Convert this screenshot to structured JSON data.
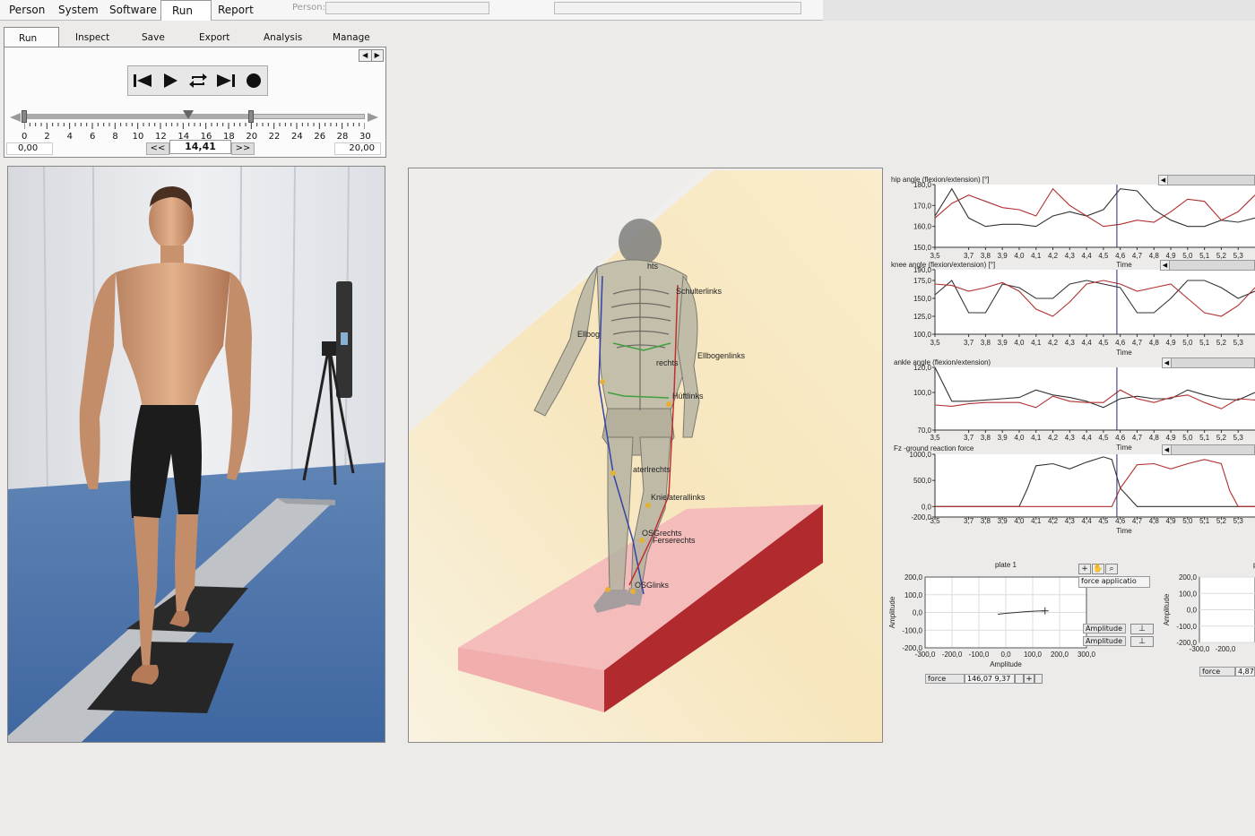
{
  "menu": {
    "items": [
      "Person",
      "System",
      "Software",
      "Run",
      "Report"
    ],
    "active": "Run",
    "person_label": "Person:"
  },
  "subtabs": {
    "items": [
      "Run",
      "Inspect",
      "Save",
      "Export",
      "Analysis",
      "Manage"
    ],
    "active": "Run"
  },
  "playback": {
    "tick_labels": [
      "0",
      "2",
      "4",
      "6",
      "8",
      "10",
      "12",
      "14",
      "16",
      "18",
      "20",
      "22",
      "24",
      "26",
      "28",
      "30"
    ],
    "start_value": "0,00",
    "current_value": "14,41",
    "end_value": "20,00",
    "step_back_label": "<<",
    "step_forward_label": ">>",
    "scale_min": 0,
    "scale_max": 30,
    "range_start": 0,
    "range_end": 20,
    "cursor_value": 14.41,
    "buttons": [
      "skip-start-icon",
      "play-icon",
      "loop-icon",
      "skip-end-icon",
      "record-icon"
    ]
  },
  "model": {
    "labels": [
      "hts",
      "Schulterlinks",
      "Ellbog",
      "Ellbogenlinks",
      "rechts",
      "Hüftlinks",
      "aterlrechts",
      "Knielaterallinks",
      "OSGrechts",
      "Ferserechts",
      "OSGlinks"
    ]
  },
  "chart_data": [
    {
      "type": "line",
      "title": "hip angle (flexion/extension) [°]",
      "xlabel": "Time",
      "x_ticks": [
        "3,5",
        "3,7",
        "3,8",
        "3,9",
        "4,0",
        "4,1",
        "4,2",
        "4,3",
        "4,4",
        "4,5",
        "4,6",
        "4,7",
        "4,8",
        "4,9",
        "5,0",
        "5,1",
        "5,2",
        "5,3"
      ],
      "y_ticks": [
        "180,0",
        "170,0",
        "160,0",
        "150,0"
      ],
      "ylim": [
        150,
        180
      ],
      "cursor_x": 4.58,
      "series": [
        {
          "color": "#333333",
          "x": [
            3.5,
            3.6,
            3.7,
            3.8,
            3.9,
            4.0,
            4.1,
            4.2,
            4.3,
            4.4,
            4.5,
            4.6,
            4.7,
            4.8,
            4.9,
            5.0,
            5.1,
            5.2,
            5.3,
            5.4
          ],
          "values": [
            165,
            178,
            164,
            160,
            161,
            161,
            160,
            165,
            167,
            165,
            168,
            178,
            177,
            168,
            163,
            160,
            160,
            163,
            162,
            164
          ]
        },
        {
          "color": "#b03030",
          "x": [
            3.5,
            3.6,
            3.7,
            3.8,
            3.9,
            4.0,
            4.1,
            4.2,
            4.3,
            4.4,
            4.5,
            4.6,
            4.7,
            4.8,
            4.9,
            5.0,
            5.1,
            5.2,
            5.3,
            5.4
          ],
          "values": [
            164,
            171,
            175,
            172,
            169,
            168,
            165,
            178,
            170,
            165,
            160,
            161,
            163,
            162,
            167,
            173,
            172,
            163,
            167,
            175
          ]
        }
      ]
    },
    {
      "type": "line",
      "title": "knee angle (flexion/extension) [°]",
      "xlabel": "Time",
      "x_ticks": [
        "3,5",
        "3,7",
        "3,8",
        "3,9",
        "4,0",
        "4,1",
        "4,2",
        "4,3",
        "4,4",
        "4,5",
        "4,6",
        "4,7",
        "4,8",
        "4,9",
        "5,0",
        "5,1",
        "5,2",
        "5,3"
      ],
      "y_ticks": [
        "190,0",
        "175,0",
        "150,0",
        "125,0",
        "100,0"
      ],
      "ylim": [
        100,
        190
      ],
      "cursor_x": 4.58,
      "series": [
        {
          "color": "#333333",
          "x": [
            3.5,
            3.6,
            3.7,
            3.8,
            3.9,
            4.0,
            4.1,
            4.2,
            4.3,
            4.4,
            4.5,
            4.6,
            4.7,
            4.8,
            4.9,
            5.0,
            5.1,
            5.2,
            5.3,
            5.4
          ],
          "values": [
            155,
            175,
            130,
            130,
            170,
            165,
            150,
            150,
            170,
            175,
            170,
            165,
            130,
            130,
            150,
            175,
            175,
            165,
            150,
            160
          ]
        },
        {
          "color": "#b03030",
          "x": [
            3.5,
            3.6,
            3.7,
            3.8,
            3.9,
            4.0,
            4.1,
            4.2,
            4.3,
            4.4,
            4.5,
            4.6,
            4.7,
            4.8,
            4.9,
            5.0,
            5.1,
            5.2,
            5.3,
            5.4
          ],
          "values": [
            170,
            168,
            160,
            165,
            172,
            160,
            135,
            125,
            145,
            170,
            175,
            170,
            160,
            165,
            170,
            150,
            130,
            125,
            140,
            165
          ]
        }
      ]
    },
    {
      "type": "line",
      "title": "ankle angle (flexion/extension)",
      "xlabel": "Time",
      "x_ticks": [
        "3,5",
        "3,7",
        "3,8",
        "3,9",
        "4,0",
        "4,1",
        "4,2",
        "4,3",
        "4,4",
        "4,5",
        "4,6",
        "4,7",
        "4,8",
        "4,9",
        "5,0",
        "5,1",
        "5,2",
        "5,3"
      ],
      "y_ticks": [
        "120,0",
        "100,0",
        "70,0"
      ],
      "ylim": [
        70,
        120
      ],
      "cursor_x": 4.58,
      "series": [
        {
          "color": "#333333",
          "x": [
            3.5,
            3.6,
            3.7,
            3.8,
            3.9,
            4.0,
            4.1,
            4.2,
            4.3,
            4.4,
            4.5,
            4.6,
            4.7,
            4.8,
            4.9,
            5.0,
            5.1,
            5.2,
            5.3,
            5.4
          ],
          "values": [
            120,
            93,
            93,
            94,
            95,
            96,
            102,
            98,
            96,
            93,
            88,
            95,
            97,
            95,
            95,
            102,
            98,
            95,
            94,
            100
          ]
        },
        {
          "color": "#b03030",
          "x": [
            3.5,
            3.6,
            3.7,
            3.8,
            3.9,
            4.0,
            4.1,
            4.2,
            4.3,
            4.4,
            4.5,
            4.6,
            4.7,
            4.8,
            4.9,
            5.0,
            5.1,
            5.2,
            5.3,
            5.4
          ],
          "values": [
            90,
            89,
            91,
            92,
            92,
            92,
            88,
            97,
            93,
            92,
            92,
            102,
            95,
            92,
            96,
            98,
            92,
            87,
            95,
            94
          ]
        }
      ]
    },
    {
      "type": "line",
      "title": "Fz -ground reaction force",
      "xlabel": "Time",
      "x_ticks": [
        "3,5",
        "3,7",
        "3,8",
        "3,9",
        "4,0",
        "4,1",
        "4,2",
        "4,3",
        "4,4",
        "4,5",
        "4,6",
        "4,7",
        "4,8",
        "4,9",
        "5,0",
        "5,1",
        "5,2",
        "5,3"
      ],
      "y_ticks": [
        "1000,0",
        "500,0",
        "0,0",
        "-200,0"
      ],
      "ylim": [
        -200,
        1000
      ],
      "cursor_x": 4.58,
      "series": [
        {
          "color": "#333333",
          "x": [
            3.5,
            3.7,
            3.9,
            4.0,
            4.05,
            4.1,
            4.2,
            4.3,
            4.4,
            4.5,
            4.55,
            4.6,
            4.7,
            4.8,
            5.0,
            5.2,
            5.3,
            5.4
          ],
          "values": [
            0,
            0,
            0,
            0,
            350,
            780,
            820,
            720,
            850,
            950,
            900,
            350,
            0,
            0,
            0,
            0,
            0,
            0
          ]
        },
        {
          "color": "#b03030",
          "x": [
            3.5,
            3.7,
            3.9,
            4.0,
            4.1,
            4.3,
            4.5,
            4.55,
            4.6,
            4.7,
            4.8,
            4.9,
            5.0,
            5.1,
            5.2,
            5.25,
            5.3,
            5.4
          ],
          "values": [
            0,
            0,
            0,
            0,
            0,
            0,
            0,
            0,
            350,
            800,
            820,
            720,
            820,
            900,
            820,
            300,
            0,
            0
          ]
        }
      ]
    },
    {
      "type": "line",
      "title": "plate 1",
      "xlabel": "Amplitude",
      "ylabel": "Amplitude",
      "x_ticks": [
        "-300,0",
        "-200,0",
        "-100,0",
        "0,0",
        "100,0",
        "200,0",
        "300,0"
      ],
      "y_ticks": [
        "200,0",
        "100,0",
        "0,0",
        "-100,0",
        "-200,0"
      ],
      "xlim": [
        -300,
        300
      ],
      "ylim": [
        -200,
        200
      ],
      "series": [
        {
          "color": "#333333",
          "x": [
            -30,
            0,
            40,
            80,
            120,
            146
          ],
          "values": [
            -10,
            -5,
            0,
            5,
            8,
            9
          ]
        }
      ]
    },
    {
      "type": "line",
      "title": "p",
      "xlabel": "",
      "ylabel": "Amplitude",
      "x_ticks": [
        "-300,0",
        "-200,0"
      ],
      "y_ticks": [
        "200,0",
        "100,0",
        "0,0",
        "-100,0",
        "-200,0"
      ],
      "series": []
    }
  ],
  "xy_panel": {
    "legend_items": [
      "force applicatio"
    ],
    "amplitude_labels": [
      "Amplitude",
      "Amplitude"
    ],
    "readout_label": "force",
    "readout_value": "146,07 9,37",
    "readout2_label": "force",
    "readout2_value": "4,87",
    "tool_icons": [
      "zoom-plus-icon",
      "hand-pan-icon",
      "magnifier-icon"
    ]
  },
  "colors": {
    "background": "#ecebe9",
    "panel": "#fbfbfb",
    "series_dark": "#333333",
    "series_red": "#b03030",
    "cursor": "#2a2a6a",
    "floor_yellow": "#f8e3b0",
    "plate_pink": "#f2b7b6"
  }
}
